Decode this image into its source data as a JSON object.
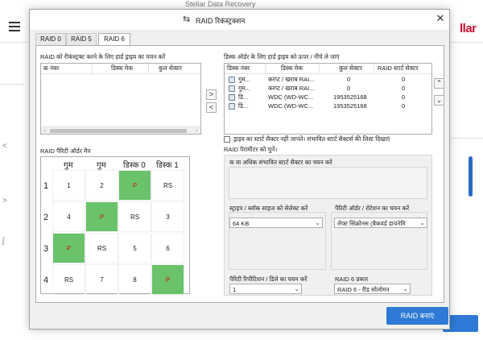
{
  "app": {
    "title": "Stellar Data Recovery",
    "brand_fragment": "llar"
  },
  "dialog": {
    "title": "RAID रिकंस्ट्रक्शन",
    "close_glyph": "✕"
  },
  "tabs": [
    {
      "label": "RAID 0"
    },
    {
      "label": "RAID 5"
    },
    {
      "label": "RAID 6"
    }
  ],
  "hdd_select": {
    "label": "RAID को रीकंस्ट्रक्ट करने के लिए हार्ड ड्राइव का चयन करें",
    "columns": [
      "क्र नंबर",
      "डिस्क मेक",
      "कुल सेक्टर"
    ]
  },
  "move_buttons": {
    "right": ">",
    "left": "<"
  },
  "disk_order": {
    "label": "डिस्क ऑर्डर के लिए हार्ड ड्राइव को ऊपर / नीचे ले जाएं",
    "columns": [
      "डिस्क नंबर",
      "डिस्क मेक",
      "कुल सेक्टर",
      "RAID स्टार्ट सेक्टर"
    ],
    "rows": [
      {
        "num": "गुम...",
        "make": "करप्ट / खराब RAI...",
        "total": "0",
        "start": "0"
      },
      {
        "num": "गुम...",
        "make": "करप्ट / खराब RAI...",
        "total": "0",
        "start": "0"
      },
      {
        "num": "डि...",
        "make": "WDC (WD-WC...",
        "total": "1953525168",
        "start": "0"
      },
      {
        "num": "डि...",
        "make": "WDC (WD-WC...",
        "total": "1953525168",
        "start": "0"
      }
    ]
  },
  "updown": {
    "up": "⌃",
    "down": "⌄"
  },
  "unknown_sector": {
    "label": "ड्राइव का स्टार्ट सैक्टर नहीं जानते। संभावित स्टार्ट सैक्टर्स की लिस्ट दिखाएं",
    "checked": false
  },
  "parity_map": {
    "label": "RAID पैरिटी ऑर्डर मैप",
    "headers": [
      "गुम",
      "गुम",
      "डिस्क 0",
      "डिस्क 1"
    ],
    "row_labels": [
      "1",
      "2",
      "3",
      "4"
    ],
    "rows": [
      [
        "1",
        "2",
        "P",
        "RS"
      ],
      [
        "4",
        "P",
        "RS",
        "3"
      ],
      [
        "P",
        "RS",
        "5",
        "6"
      ],
      [
        "RS",
        "7",
        "8",
        "P"
      ]
    ],
    "parity_color": "#6ac26a"
  },
  "raid_params": {
    "label": "RAID पैरामीटर को चुनें।",
    "start_sector_label": "क या अधिक संभावित स्टार्ट सैक्टर का चयन करें",
    "stripe_label": "स्ट्राइप / ब्लॉक साइज को सेलेक्ट करें",
    "stripe_value": "64 KB",
    "parity_order_label": "पैरिटी ऑर्डर / रोटेशन का चयन करें",
    "parity_order_value": "लेफ्ट सिंक्रोनस (बैकवर्ड डायनेमि",
    "repetition_label": "पैरिटी रिपीटिशन / डिले का चयन करें",
    "repetition_value": "1",
    "raid6_type_label": "RAID 6 प्रकार",
    "raid6_type_value": "RAID 6 - रीड सोलोमन"
  },
  "build_button": "RAID बनाएं",
  "colors": {
    "accent": "#2e7ad6",
    "brand": "#c8102e"
  }
}
